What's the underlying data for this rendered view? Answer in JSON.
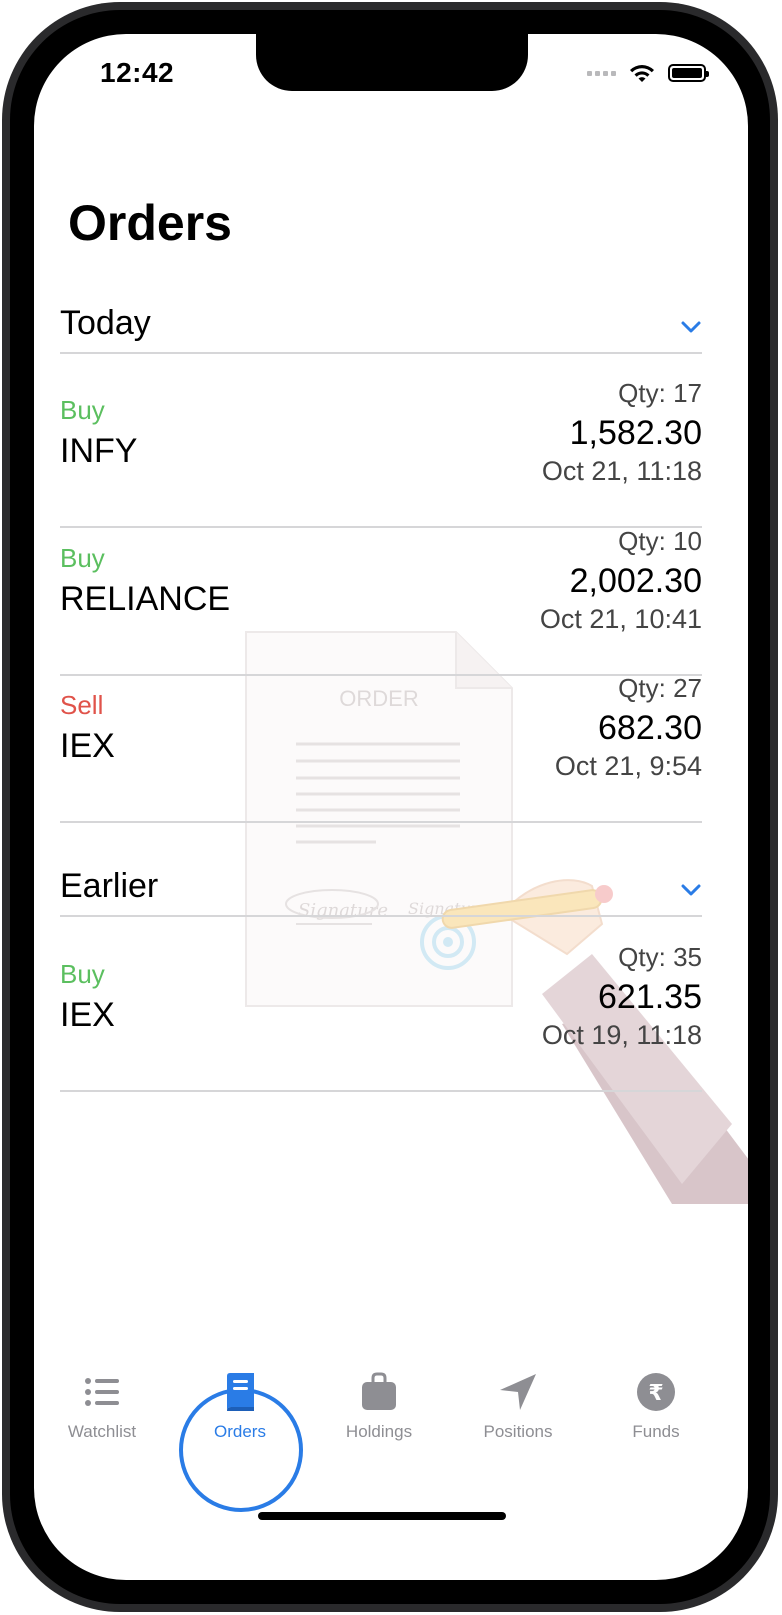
{
  "status_bar": {
    "time": "12:42"
  },
  "page": {
    "title": "Orders"
  },
  "sections": [
    {
      "label": "Today",
      "orders": [
        {
          "side": "Buy",
          "symbol": "INFY",
          "qty": "Qty: 17",
          "price": "1,582.30",
          "time": "Oct 21, 11:18"
        },
        {
          "side": "Buy",
          "symbol": "RELIANCE",
          "qty": "Qty: 10",
          "price": "2,002.30",
          "time": "Oct 21, 10:41"
        },
        {
          "side": "Sell",
          "symbol": "IEX",
          "qty": "Qty: 27",
          "price": "682.30",
          "time": "Oct 21, 9:54"
        }
      ]
    },
    {
      "label": "Earlier",
      "orders": [
        {
          "side": "Buy",
          "symbol": "IEX",
          "qty": "Qty: 35",
          "price": "621.35",
          "time": "Oct 19, 11:18"
        }
      ]
    }
  ],
  "illustration": {
    "document_heading": "ORDER",
    "signature_left": "Signature",
    "signature_right": "Signature"
  },
  "tabs": [
    {
      "label": "Watchlist",
      "icon": "list-icon",
      "active": false
    },
    {
      "label": "Orders",
      "icon": "book-icon",
      "active": true
    },
    {
      "label": "Holdings",
      "icon": "bag-icon",
      "active": false
    },
    {
      "label": "Positions",
      "icon": "location-arrow-icon",
      "active": false
    },
    {
      "label": "Funds",
      "icon": "rupee-icon",
      "active": false
    }
  ],
  "colors": {
    "accent": "#2a7ce6",
    "buy": "#5bbf5f",
    "sell": "#e0534a",
    "divider": "#d6d6d8",
    "tab_inactive": "#8e8e93"
  }
}
